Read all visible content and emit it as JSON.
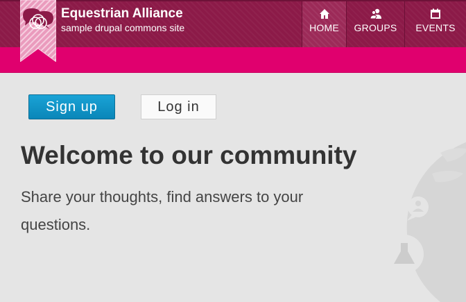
{
  "site": {
    "name": "Equestrian Alliance",
    "slogan": "sample drupal commons site"
  },
  "nav": {
    "items": [
      {
        "label": "HOME",
        "icon": "home-icon",
        "active": true
      },
      {
        "label": "GROUPS",
        "icon": "groups-icon",
        "active": false
      },
      {
        "label": "EVENTS",
        "icon": "calendar-icon",
        "active": false
      }
    ]
  },
  "actions": {
    "signup_label": "Sign up",
    "login_label": "Log in"
  },
  "welcome": {
    "title": "Welcome to our community",
    "text": "Share your thoughts, find answers to your questions."
  },
  "colors": {
    "header": "#8c1a48",
    "accent_bar": "#e0006e",
    "signup_button": "#0a86b8",
    "background": "#e5e5e5"
  }
}
